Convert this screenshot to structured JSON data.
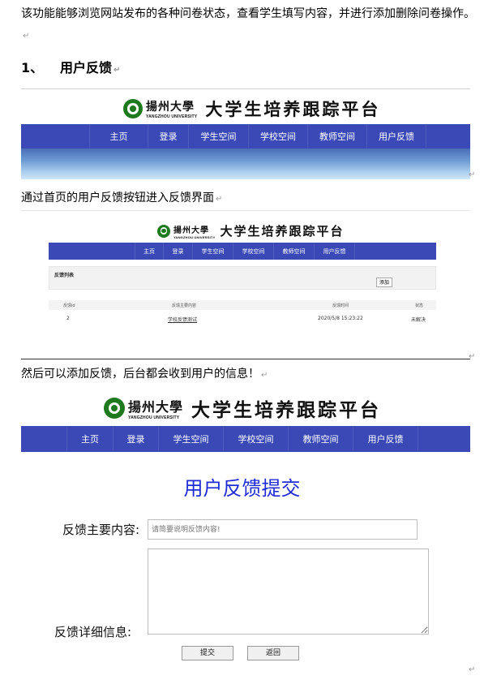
{
  "intro": "该功能能够浏览网站发布的各种问卷状态，查看学生填写内容，并进行添加删除问卷操作。",
  "paragraph_mark": "↵",
  "heading": {
    "number": "1、",
    "text": "用户反馈"
  },
  "banner": {
    "university_cn": "揚州大學",
    "university_en": "YANGZHOU UNIVERSITY",
    "platform_title": "大学生培养跟踪平台",
    "nav": [
      "主页",
      "登录",
      "学生空间",
      "学校空间",
      "教师空间",
      "用户反馈"
    ]
  },
  "caption1": "通过首页的用户反馈按钮进入反馈界面",
  "feedback_list": {
    "panel_title": "反馈列表",
    "add_button": "添加",
    "columns": [
      "反馈id",
      "反馈主要内容",
      "反馈时间",
      "状态"
    ],
    "rows": [
      {
        "id": "2",
        "content": "学校反馈测试",
        "time": "2020/5/8 15:23:22",
        "status": "未解决"
      }
    ]
  },
  "caption2": "然后可以添加反馈，后台都会收到用户的信息！",
  "form": {
    "title": "用户反馈提交",
    "main_label": "反馈主要内容:",
    "main_placeholder": "请简要说明反馈内容!",
    "detail_label": "反馈详细信息:",
    "submit": "提交",
    "back": "返回"
  }
}
